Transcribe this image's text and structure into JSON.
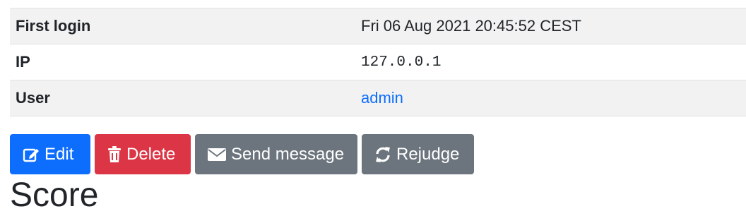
{
  "details": {
    "rows": [
      {
        "label": "First login",
        "value": "Fri 06 Aug 2021 20:45:52 CEST"
      },
      {
        "label": "IP",
        "value": "127.0.0.1"
      },
      {
        "label": "User",
        "value": "admin"
      }
    ]
  },
  "actions": {
    "edit_label": "Edit",
    "delete_label": "Delete",
    "send_message_label": "Send message",
    "rejudge_label": "Rejudge"
  },
  "score_section": {
    "title": "Score"
  },
  "icons": {
    "edit": "pencil-square-icon",
    "delete": "trash-icon",
    "send_message": "envelope-icon",
    "rejudge": "sync-icon"
  },
  "colors": {
    "primary": "#0d6efd",
    "danger": "#dc3545",
    "secondary": "#6c757d",
    "link": "#0d6efd"
  }
}
